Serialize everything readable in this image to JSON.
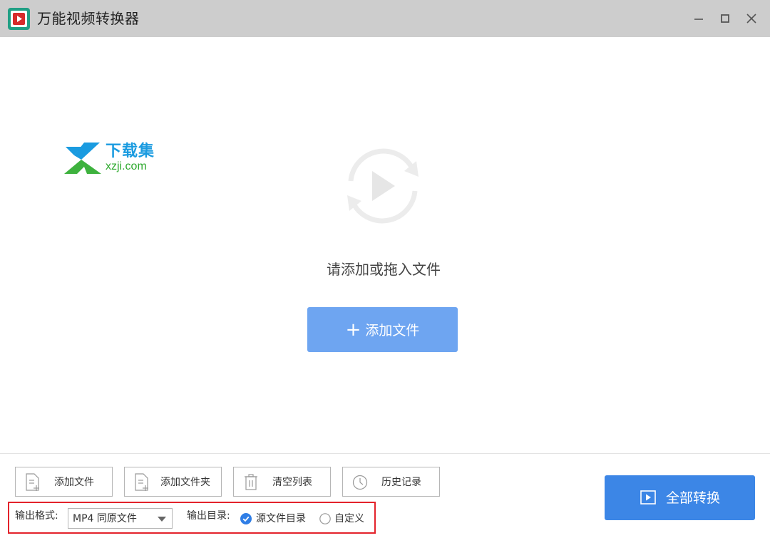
{
  "window": {
    "title": "万能视频转换器",
    "controls": {
      "minimize": "minimize-icon",
      "maximize": "maximize-icon",
      "close": "close-icon"
    }
  },
  "watermark": {
    "name": "下载集",
    "url": "xzji.com"
  },
  "dropzone": {
    "hint": "请添加或拖入文件",
    "add_button_label": "添加文件",
    "add_button_icon": "plus-icon",
    "illustration": "play-convert-icon"
  },
  "toolbar": {
    "buttons": [
      {
        "label": "添加文件",
        "icon": "add-file-icon"
      },
      {
        "label": "添加文件夹",
        "icon": "add-folder-icon"
      },
      {
        "label": "清空列表",
        "icon": "trash-icon"
      },
      {
        "label": "历史记录",
        "icon": "clock-icon"
      }
    ]
  },
  "settings": {
    "format_label": "输出格式:",
    "format_value": "MP4 同原文件",
    "dir_label": "输出目录:",
    "dir_options": [
      {
        "label": "源文件目录",
        "checked": true
      },
      {
        "label": "自定义",
        "checked": false
      }
    ]
  },
  "convert": {
    "label": "全部转换",
    "icon": "play-square-icon"
  },
  "colors": {
    "titlebar": "#cdcdcd",
    "primary": "#3c86e6",
    "primary_light": "#6ea5f1",
    "highlight_border": "#e3232b"
  }
}
